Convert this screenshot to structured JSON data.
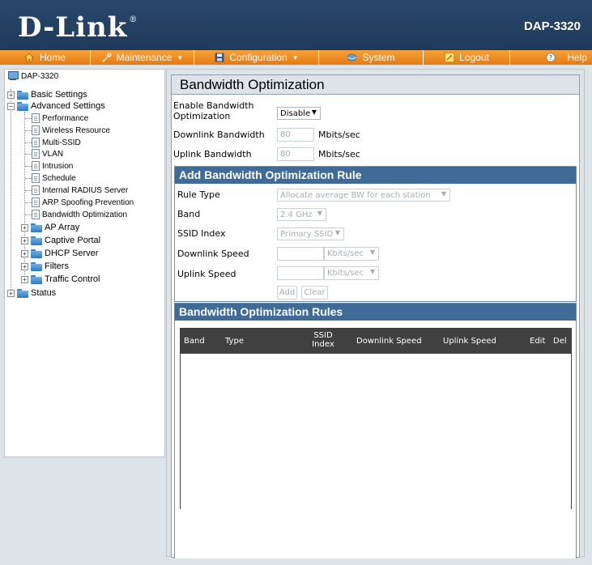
{
  "header": {
    "brand": "D-Link",
    "registered_mark": "®",
    "model": "DAP-3320"
  },
  "nav": [
    {
      "label": "Home",
      "icon": "home-icon"
    },
    {
      "label": "Maintenance",
      "icon": "tools-icon",
      "dropdown": true
    },
    {
      "label": "Configuration",
      "icon": "save-disk-icon",
      "dropdown": true
    },
    {
      "label": "System",
      "icon": "globe-icon"
    },
    {
      "label": "Logout",
      "icon": "logout-key-icon"
    },
    {
      "label": "Help",
      "icon": "help-icon"
    }
  ],
  "tree": {
    "root": "DAP-3320",
    "basic_settings": "Basic Settings",
    "advanced_settings": "Advanced Settings",
    "advanced_children": [
      "Performance",
      "Wireless Resource",
      "Multi-SSID",
      "VLAN",
      "Intrusion",
      "Schedule",
      "Internal RADIUS Server",
      "ARP Spoofing Prevention",
      "Bandwidth Optimization"
    ],
    "advanced_folders": [
      "AP Array",
      "Captive Portal",
      "DHCP Server",
      "Filters",
      "Traffic Control"
    ],
    "status": "Status"
  },
  "page": {
    "title": "Bandwidth Optimization",
    "enable_label_1": "Enable Bandwidth",
    "enable_label_2": "Optimization",
    "enable_value": "Disable",
    "downlink_bw_label": "Downlink Bandwidth",
    "downlink_bw_value": "80",
    "downlink_bw_unit": "Mbits/sec",
    "uplink_bw_label": "Uplink Bandwidth",
    "uplink_bw_value": "80",
    "uplink_bw_unit": "Mbits/sec"
  },
  "add_rule": {
    "header": "Add Bandwidth Optimization Rule",
    "rule_type_label": "Rule Type",
    "rule_type_value": "Allocate average BW for each station",
    "band_label": "Band",
    "band_value": "2.4 GHz",
    "ssid_label": "SSID Index",
    "ssid_value": "Primary SSID",
    "downlink_speed_label": "Downlink Speed",
    "downlink_speed_unit": "Kbits/sec",
    "uplink_speed_label": "Uplink Speed",
    "uplink_speed_unit": "Kbits/sec",
    "add_button": "Add",
    "clear_button": "Clear"
  },
  "rules": {
    "header": "Bandwidth Optimization Rules",
    "columns": {
      "band": "Band",
      "type": "Type",
      "ssid_1": "SSID",
      "ssid_2": "Index",
      "downlink": "Downlink Speed",
      "uplink": "Uplink Speed",
      "edit": "Edit",
      "del": "Del"
    },
    "rows": []
  },
  "colors": {
    "header_bg": "#29486b",
    "nav_bg": "#f08a1f",
    "section_header": "#3f6b96",
    "table_header": "#404040"
  }
}
